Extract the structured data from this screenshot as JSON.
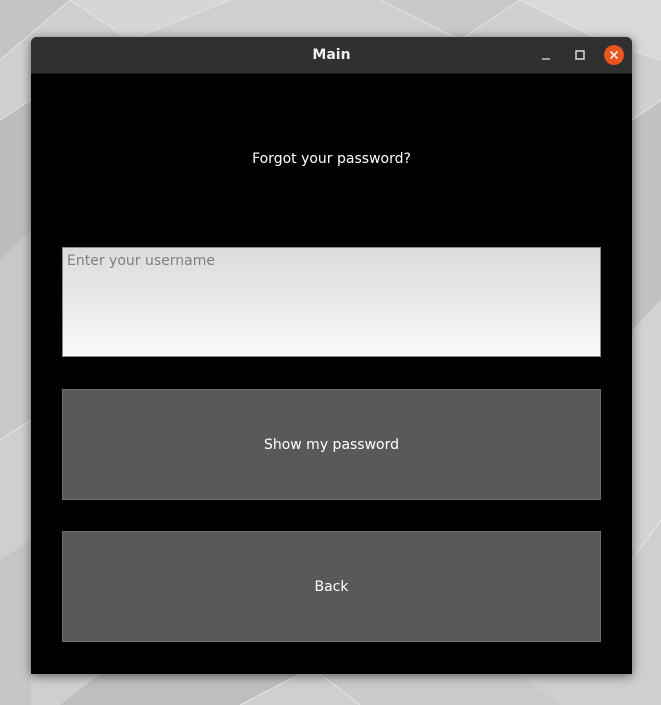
{
  "window": {
    "title": "Main",
    "controls": {
      "minimize_icon": "minimize-icon",
      "maximize_icon": "maximize-icon",
      "close_icon": "close-icon"
    }
  },
  "form": {
    "heading": "Forgot your password?",
    "username_placeholder": "Enter your username",
    "username_value": "",
    "show_password_label": "Show my password",
    "back_label": "Back"
  },
  "colors": {
    "window_background": "#000000",
    "titlebar": "#303030",
    "close_button": "#e95420",
    "button_background": "#595959",
    "text": "#ffffff"
  }
}
